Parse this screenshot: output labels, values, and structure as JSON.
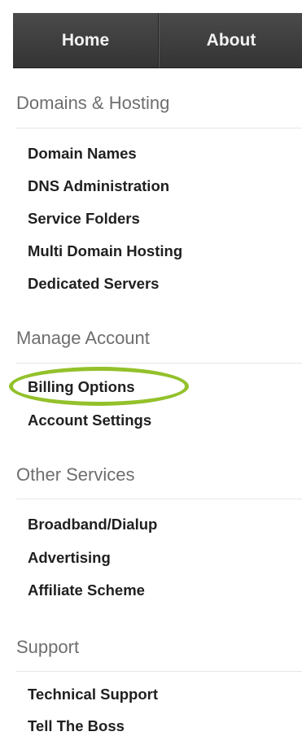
{
  "nav": {
    "home": "Home",
    "about": "About"
  },
  "sections": {
    "domains": {
      "title": "Domains & Hosting",
      "items": [
        "Domain Names",
        "DNS Administration",
        "Service Folders",
        "Multi Domain Hosting",
        "Dedicated Servers"
      ]
    },
    "account": {
      "title": "Manage Account",
      "items": [
        "Billing Options",
        "Account Settings"
      ]
    },
    "other": {
      "title": "Other Services",
      "items": [
        "Broadband/Dialup",
        "Advertising",
        "Affiliate Scheme"
      ]
    },
    "support": {
      "title": "Support",
      "items": [
        "Technical Support",
        "Tell The Boss"
      ]
    }
  },
  "highlight_color": "#93c12b"
}
